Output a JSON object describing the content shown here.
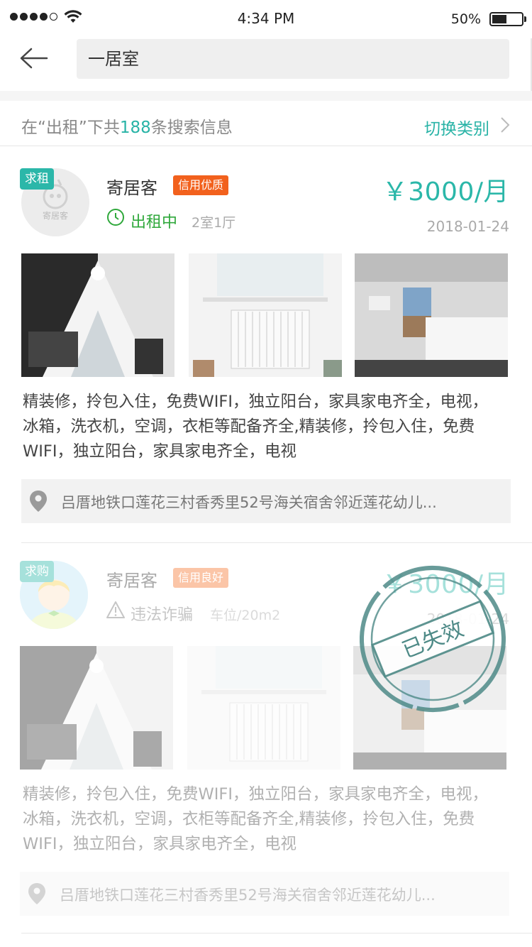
{
  "status_bar": {
    "time": "4:34 PM",
    "battery": "50%"
  },
  "search": {
    "value": "一居室"
  },
  "result_bar": {
    "prefix": "在“出租”下共",
    "count": "188",
    "suffix": "条搜索信息",
    "switch_label": "切换类别"
  },
  "listings": [
    {
      "tag": "求租",
      "avatar_text": "寄居客",
      "name": "寄居客",
      "credit": "信用优质",
      "status": "出租中",
      "rooms": "2室1厅",
      "price": "￥3000/月",
      "date": "2018-01-24",
      "description": "精装修，拎包入住，免费WIFI，独立阳台，家具家电齐全，电视，冰箱，洗衣机，空调，衣柜等配备齐全,精装修，拎包入住，免费WIFI，独立阳台，家具家电齐全，电视",
      "address": "吕厝地铁口莲花三村香秀里52号海关宿舍邻近莲花幼儿..."
    },
    {
      "tag": "求购",
      "name": "寄居客",
      "credit": "信用良好",
      "status": "违法诈骗",
      "rooms": "车位/20m2",
      "price": "￥3000/月",
      "date": "2018-01-24",
      "description": "精装修，拎包入住，免费WIFI，独立阳台，家具家电齐全，电视，冰箱，洗衣机，空调，衣柜等配备齐全,精装修，拎包入住，免费WIFI，独立阳台，家具家电齐全，电视",
      "address": "吕厝地铁口莲花三村香秀里52号海关宿舍邻近莲花幼儿...",
      "stamp": "已失效"
    }
  ],
  "colors": {
    "accent": "#2bb7a9",
    "credit_orange": "#f2611d",
    "status_green": "#2fa83b"
  }
}
